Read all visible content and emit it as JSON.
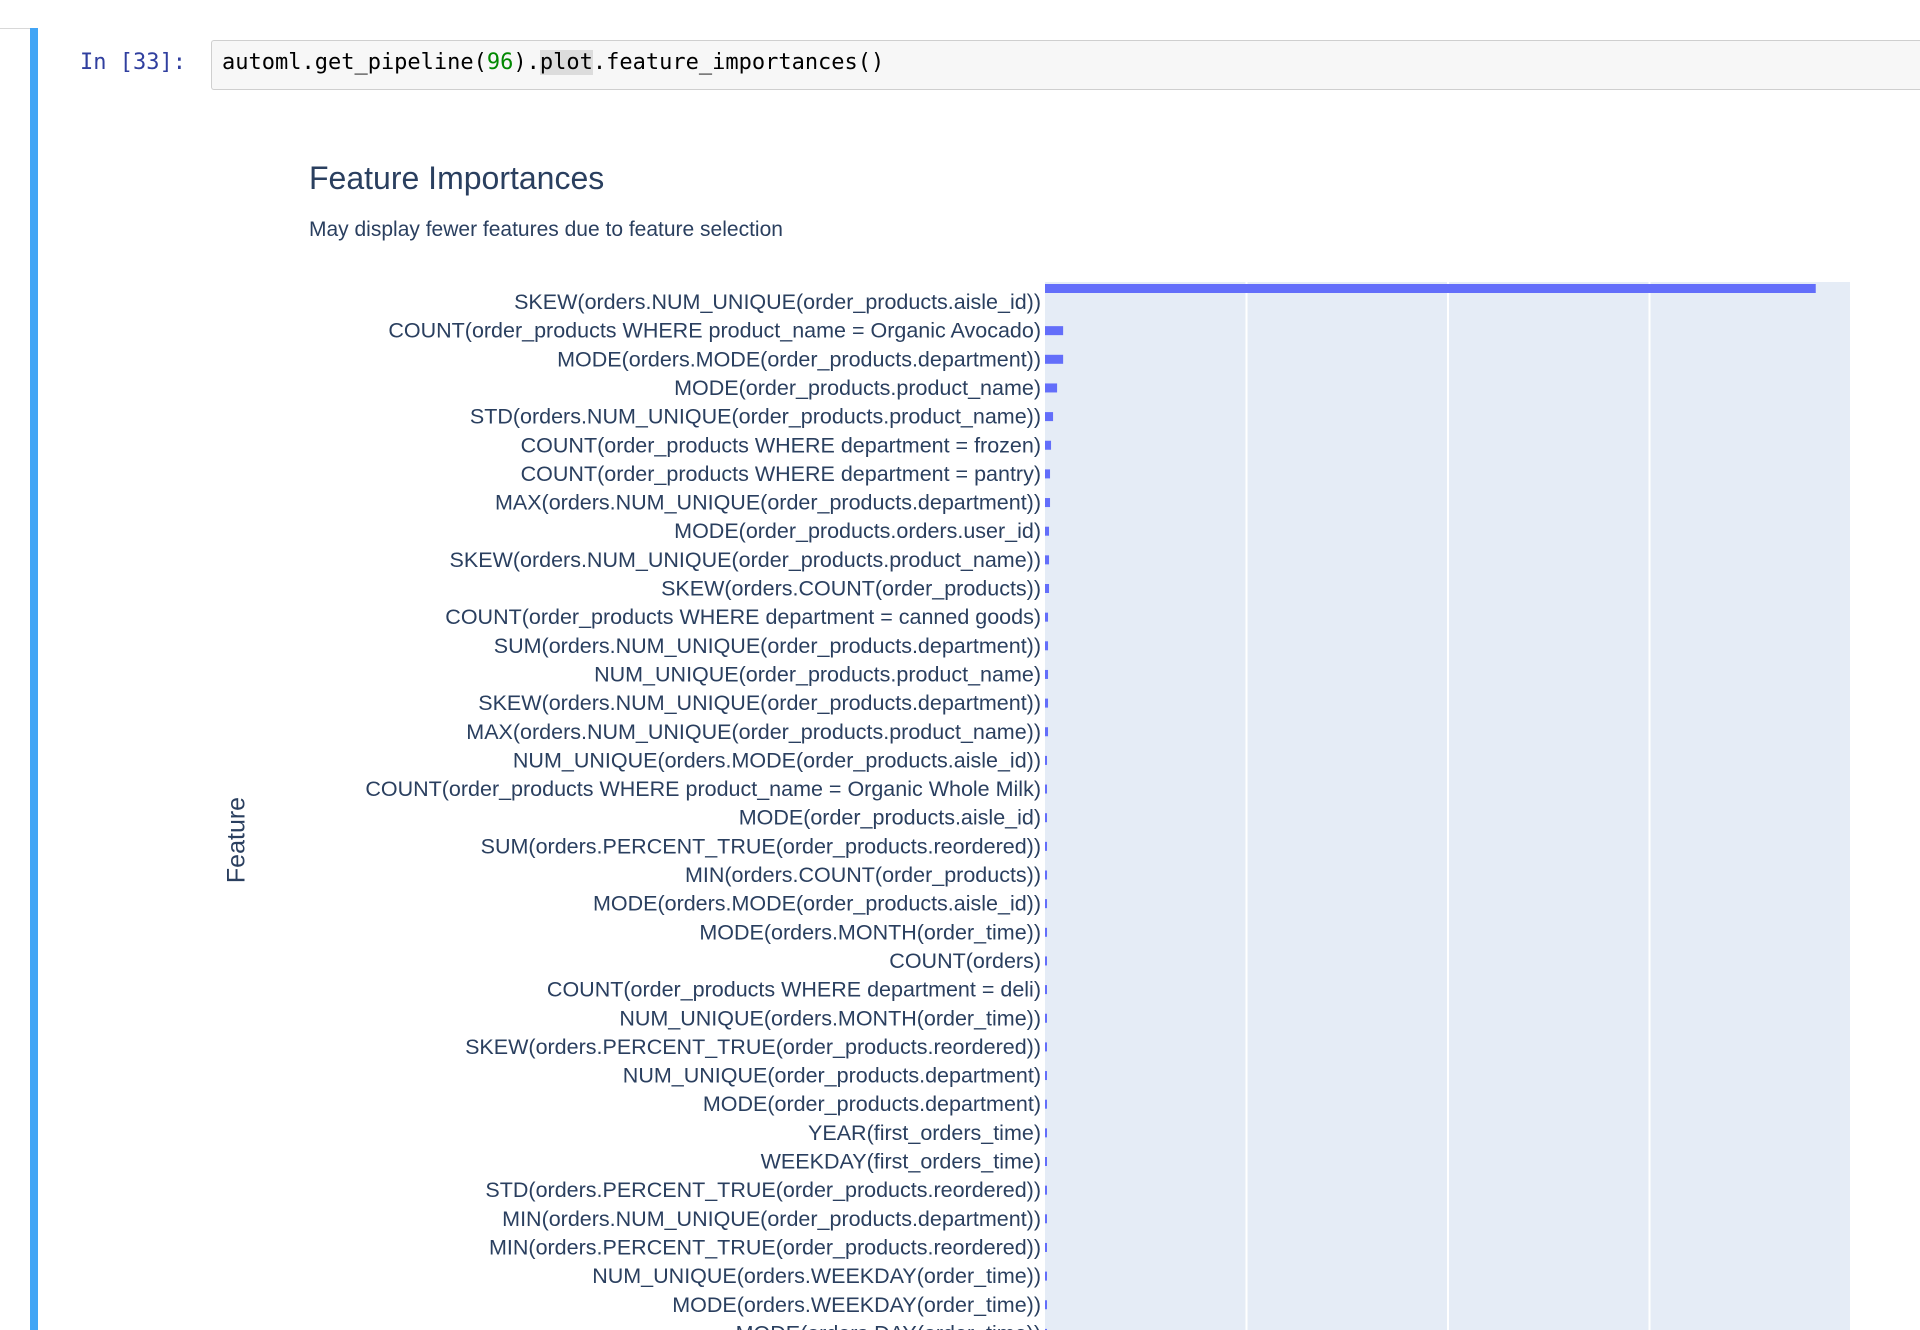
{
  "notebook": {
    "prompt": "In [33]:",
    "code": {
      "before_num": "automl.get_pipeline(",
      "num": "96",
      "between": ").",
      "highlight": "plot",
      "after": ".feature_importances()"
    }
  },
  "colors": {
    "bar": "#636efa",
    "plot_bg": "#e5ecf6",
    "cell_accent": "#42a5f5",
    "text": "#2a3f5f"
  },
  "chart_data": {
    "type": "bar",
    "orientation": "horizontal",
    "title": "Feature Importances",
    "subtitle": "May display fewer features due to feature selection",
    "ylabel": "Feature",
    "xlim": [
      0,
      0.8
    ],
    "grid": true,
    "categories": [
      "SKEW(orders.NUM_UNIQUE(order_products.aisle_id))",
      "COUNT(order_products WHERE product_name = Organic Avocado)",
      "MODE(orders.MODE(order_products.department))",
      "MODE(order_products.product_name)",
      "STD(orders.NUM_UNIQUE(order_products.product_name))",
      "COUNT(order_products WHERE department = frozen)",
      "COUNT(order_products WHERE department = pantry)",
      "MAX(orders.NUM_UNIQUE(order_products.department))",
      "MODE(order_products.orders.user_id)",
      "SKEW(orders.NUM_UNIQUE(order_products.product_name))",
      "SKEW(orders.COUNT(order_products))",
      "COUNT(order_products WHERE department = canned goods)",
      "SUM(orders.NUM_UNIQUE(order_products.department))",
      "NUM_UNIQUE(order_products.product_name)",
      "SKEW(orders.NUM_UNIQUE(order_products.department))",
      "MAX(orders.NUM_UNIQUE(order_products.product_name))",
      "NUM_UNIQUE(orders.MODE(order_products.aisle_id))",
      "COUNT(order_products WHERE product_name = Organic Whole Milk)",
      "MODE(order_products.aisle_id)",
      "SUM(orders.PERCENT_TRUE(order_products.reordered))",
      "MIN(orders.COUNT(order_products))",
      "MODE(orders.MODE(order_products.aisle_id))",
      "MODE(orders.MONTH(order_time))",
      "COUNT(orders)",
      "COUNT(order_products WHERE department = deli)",
      "NUM_UNIQUE(orders.MONTH(order_time))",
      "SKEW(orders.PERCENT_TRUE(order_products.reordered))",
      "NUM_UNIQUE(order_products.department)",
      "MODE(order_products.department)",
      "YEAR(first_orders_time)",
      "WEEKDAY(first_orders_time)",
      "STD(orders.PERCENT_TRUE(order_products.reordered))",
      "MIN(orders.NUM_UNIQUE(order_products.department))",
      "MIN(orders.PERCENT_TRUE(order_products.reordered))",
      "NUM_UNIQUE(orders.WEEKDAY(order_time))",
      "MODE(orders.WEEKDAY(order_time))",
      "MODE(orders.DAY(order_time))"
    ],
    "values": [
      0.765,
      0.018,
      0.018,
      0.012,
      0.008,
      0.006,
      0.005,
      0.005,
      0.004,
      0.004,
      0.004,
      0.003,
      0.003,
      0.003,
      0.003,
      0.003,
      0.002,
      0.002,
      0.002,
      0.002,
      0.002,
      0.002,
      0.002,
      0.001,
      0.001,
      0.001,
      0.001,
      0.001,
      0.001,
      0.001,
      0.001,
      0.001,
      0.001,
      0.001,
      0.001,
      0.001,
      0.001
    ]
  }
}
